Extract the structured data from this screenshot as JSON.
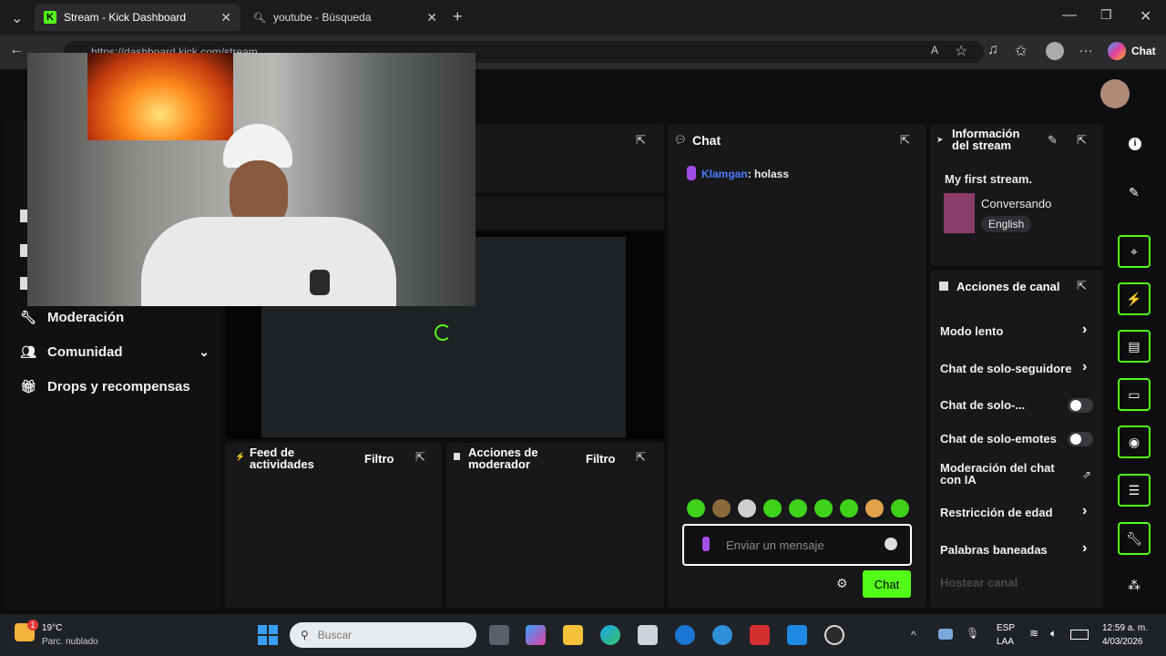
{
  "browser": {
    "tabs": [
      {
        "title": "Stream - Kick Dashboard",
        "active": true
      },
      {
        "title": "youtube - Búsqueda",
        "active": false
      }
    ],
    "url": "https://dashboard.kick.com/stream",
    "copilot_label": "Chat"
  },
  "sidebar": {
    "items": [
      {
        "label": "Moderación",
        "icon": "wrench-icon"
      },
      {
        "label": "Comunidad",
        "icon": "users-icon"
      },
      {
        "label": "Drops y recompensas",
        "icon": "gift-icon"
      }
    ]
  },
  "chat": {
    "title": "Chat",
    "messages": [
      {
        "user": "Klamgan",
        "text": ": holass"
      }
    ],
    "input_placeholder": "Enviar un mensaje",
    "send_label": "Chat"
  },
  "stream_info": {
    "title": "Información del stream",
    "stream_title": "My first stream.",
    "category": "Conversando",
    "language": "English"
  },
  "channel_actions": {
    "title": "Acciones de canal",
    "rows": [
      {
        "label": "Modo lento",
        "control": "chevron"
      },
      {
        "label": "Chat de solo-seguidore",
        "control": "chevron"
      },
      {
        "label": "Chat de solo-...",
        "control": "toggle"
      },
      {
        "label": "Chat de solo-emotes",
        "control": "toggle"
      },
      {
        "label": "Moderación del chat con IA",
        "control": "chart"
      },
      {
        "label": "Restricción de edad",
        "control": "chevron"
      },
      {
        "label": "Palabras baneadas",
        "control": "chevron"
      }
    ],
    "host_label": "Hostear canal"
  },
  "activity_feed": {
    "title": "Feed de actividades",
    "filter_label": "Filtro"
  },
  "mod_actions": {
    "title": "Acciones de moderador",
    "filter_label": "Filtro"
  },
  "colors": {
    "accent": "#53fc18",
    "panel": "#18181b",
    "bg": "#0e0e10"
  },
  "taskbar": {
    "weather_temp": "19°C",
    "weather_desc": "Parc. nublado",
    "search_placeholder": "Buscar",
    "lang_top": "ESP",
    "lang_bottom": "LAA",
    "time": "12:59 a. m.",
    "date": "4/03/2026",
    "notification_count": "1"
  }
}
